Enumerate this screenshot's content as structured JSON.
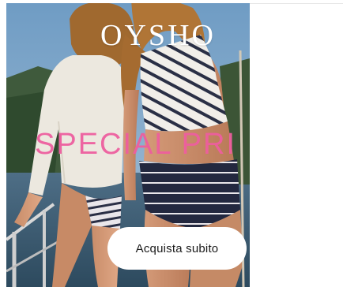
{
  "ad": {
    "brand": "OYSHO",
    "promo_text": "SPECIAL PRI",
    "cta_label": "Acquista subito"
  },
  "colors": {
    "brand_text": "#ffffff",
    "promo_text": "#ee5e9f",
    "cta_background": "#ffffff",
    "cta_text": "#1a1a1a"
  }
}
